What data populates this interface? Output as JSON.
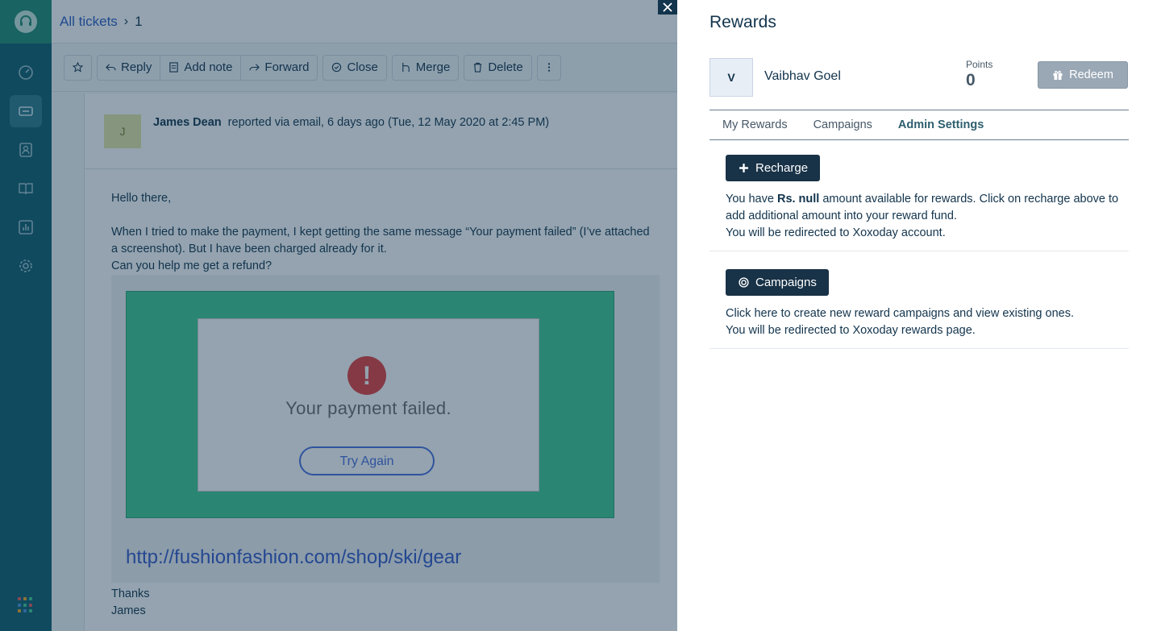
{
  "breadcrumb": {
    "all_tickets": "All tickets",
    "separator": "›",
    "current": "1"
  },
  "toolbar": {
    "reply": "Reply",
    "add_note": "Add note",
    "forward": "Forward",
    "close": "Close",
    "merge": "Merge",
    "delete": "Delete"
  },
  "ticket": {
    "avatar_initial": "J",
    "requester": "James Dean",
    "reported": "reported via email, 6 days ago (Tue, 12 May 2020 at 2:45 PM)",
    "body": [
      "Hello there,",
      "",
      "When I tried to make the payment, I kept getting the same message “Your payment failed” (I’ve attached a screenshot). But I have been charged already for it.",
      "Can you help me get a refund?"
    ],
    "attachment": {
      "error_icon": "!",
      "error_text": "Your payment failed.",
      "try_again": "Try Again",
      "url": "http://fushionfashion.com/shop/ski/gear"
    },
    "signoff_1": "Thanks",
    "signoff_2": "James"
  },
  "panel": {
    "title": "Rewards",
    "user_initial": "V",
    "user_name": "Vaibhav Goel",
    "points_label": "Points",
    "points_value": "0",
    "redeem_label": "Redeem",
    "tabs": [
      {
        "label": "My Rewards",
        "active": false
      },
      {
        "label": "Campaigns",
        "active": false
      },
      {
        "label": "Admin Settings",
        "active": true
      }
    ],
    "recharge": {
      "button": "Recharge",
      "text_pre": "You have ",
      "text_bold": "Rs. null",
      "text_post": " amount available for rewards. Click on recharge above to add additional amount into your reward fund.",
      "text_line2": "You will be redirected to Xoxoday account."
    },
    "campaigns": {
      "button": "Campaigns",
      "text_line1": "Click here to create new reward campaigns and view existing ones.",
      "text_line2": "You will be redirected to Xoxoday rewards page."
    }
  },
  "colors": {
    "nav_bg": "#0f5e6e",
    "brand_green": "#1f8a74",
    "dark_button": "#183247",
    "redeem_disabled": "#9aa8b5",
    "link_blue": "#2c5cc5"
  }
}
